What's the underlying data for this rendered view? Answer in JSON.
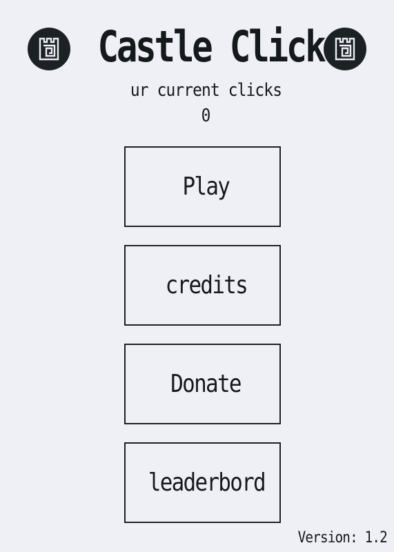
{
  "header": {
    "title": "Castle Clicker",
    "left_logo_icon": "castle-tower-icon",
    "right_logo_icon": "castle-tower-icon"
  },
  "stats": {
    "label": "ur current clicks",
    "clicks": "0"
  },
  "menu": {
    "play_label": "Play",
    "credits_label": "credits",
    "donate_label": "Donate",
    "leaderboard_label": "leaderbord"
  },
  "footer": {
    "version": "Version: 1.2"
  },
  "colors": {
    "background": "#eef0f6",
    "foreground": "#16191c",
    "logo_bg": "#1c2124"
  }
}
